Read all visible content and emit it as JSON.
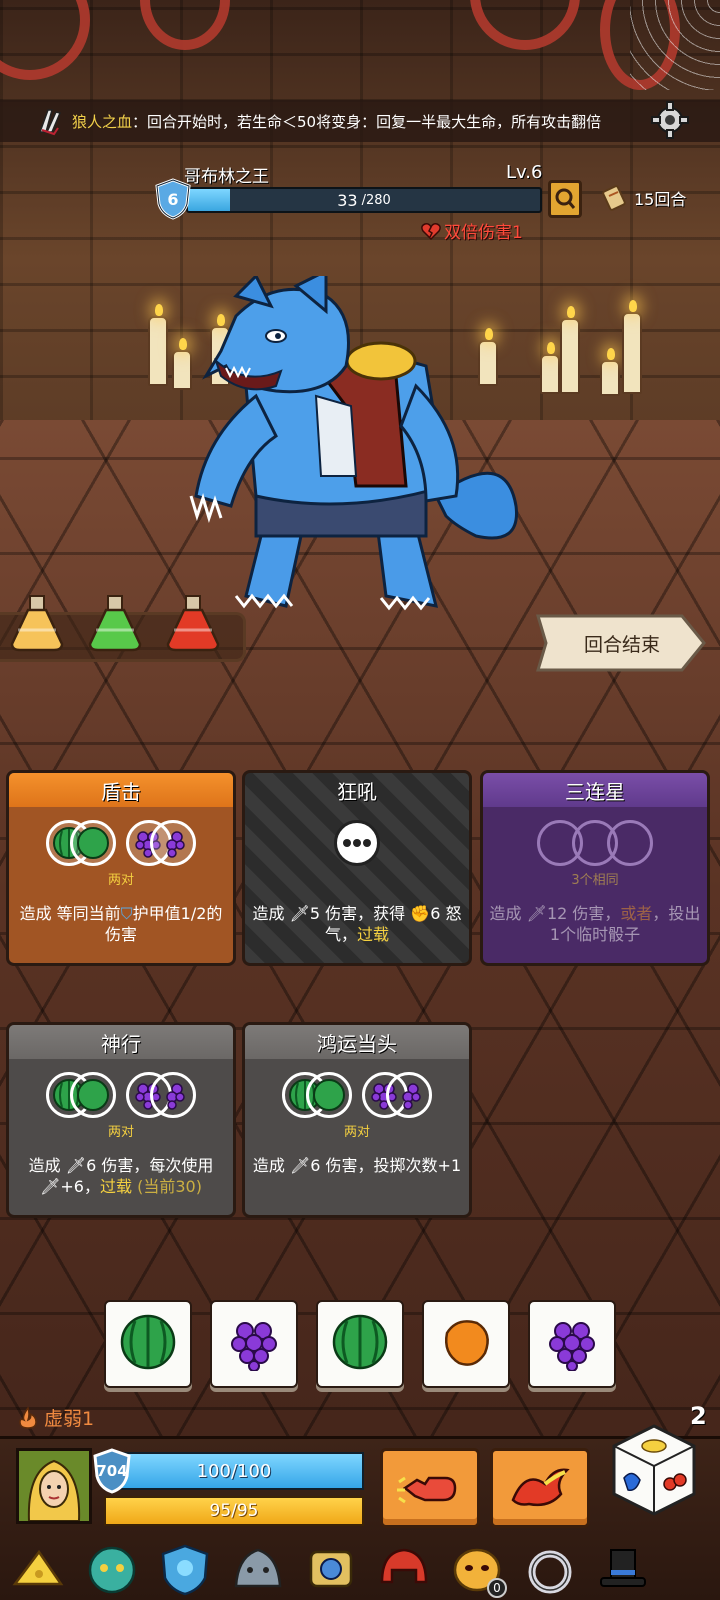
{
  "buff": {
    "icon": "werewolf-claw-icon",
    "name": "狼人之血",
    "description": "：回合开始时，若生命＜50将变身：回复一半最大生命，所有攻击翻倍"
  },
  "enemy": {
    "name": "哥布林之王",
    "level": "Lv.6",
    "armor": "6",
    "hp_current": "33",
    "hp_max": "/280",
    "hp_fraction": 0.118,
    "debuff_label": "双倍伤害1",
    "debuff_icon": "broken-heart-icon",
    "monster": "blue-werewolf-with-red-vest"
  },
  "turns": {
    "label": "15回合",
    "icon": "scroll-icon"
  },
  "potions": [
    {
      "name": "orange-potion-icon",
      "color": "#f6c35a"
    },
    {
      "name": "green-potion-icon",
      "color": "#58c94a"
    },
    {
      "name": "red-gold-potion-icon",
      "color": "#e23a26"
    }
  ],
  "end_turn": {
    "label": "回合结束"
  },
  "cards": [
    {
      "title": "盾击",
      "requirement": "两对",
      "desc_a": "造成 等同当前",
      "desc_b": "护甲值1/2的伤害"
    },
    {
      "title": "狂吼",
      "desc_a": "造成 ",
      "desc_dmg": "5",
      "desc_b": " 伤害，获得 ",
      "desc_rage": "6",
      "desc_c": " 怒气，",
      "desc_kw": "过载"
    },
    {
      "title": "三连星",
      "requirement": "3个相同",
      "desc_a": "造成 ",
      "desc_dmg": "12",
      "desc_b": " 伤害，",
      "desc_kw": "或者",
      "desc_c": "，投出1个临时骰子"
    },
    {
      "title": "神行",
      "requirement": "两对",
      "desc_a": "造成 ",
      "desc_dmg": "6",
      "desc_b": " 伤害，每次使用",
      "desc_inc": "+6",
      "desc_comma": "，",
      "desc_kw": "过载",
      "desc_cur": " (当前30)"
    },
    {
      "title": "鸿运当头",
      "requirement": "两对",
      "desc_a": "造成 ",
      "desc_dmg": "6",
      "desc_b": " 伤害，投掷次数+1"
    }
  ],
  "dice": [
    "watermelon-icon",
    "grapes-icon",
    "watermelon-icon",
    "mango-icon",
    "grapes-icon"
  ],
  "player": {
    "status": "虚弱1",
    "status_icon": "weak-flame-icon",
    "armor": "704",
    "hp": "100/100",
    "energy": "95/95",
    "rolls_left": "2",
    "portrait": "blonde-hero-portrait"
  },
  "actions": [
    "fist-punch-icon",
    "fire-strike-icon"
  ],
  "relics": [
    {
      "name": "cheese-wedge-icon"
    },
    {
      "name": "jade-lion-mask-icon"
    },
    {
      "name": "blue-gem-shield-icon"
    },
    {
      "name": "stone-dragon-head-icon"
    },
    {
      "name": "compass-armor-icon"
    },
    {
      "name": "red-helmet-icon"
    },
    {
      "name": "golden-mask-icon",
      "count": "0"
    },
    {
      "name": "silver-ring-icon"
    },
    {
      "name": "magic-top-hat-icon"
    }
  ],
  "colors": {
    "hp_bar": "#3aa6e0",
    "energy_bar": "#f0a818",
    "highlight": "#f4d040",
    "debuff": "#ff4a3a"
  }
}
